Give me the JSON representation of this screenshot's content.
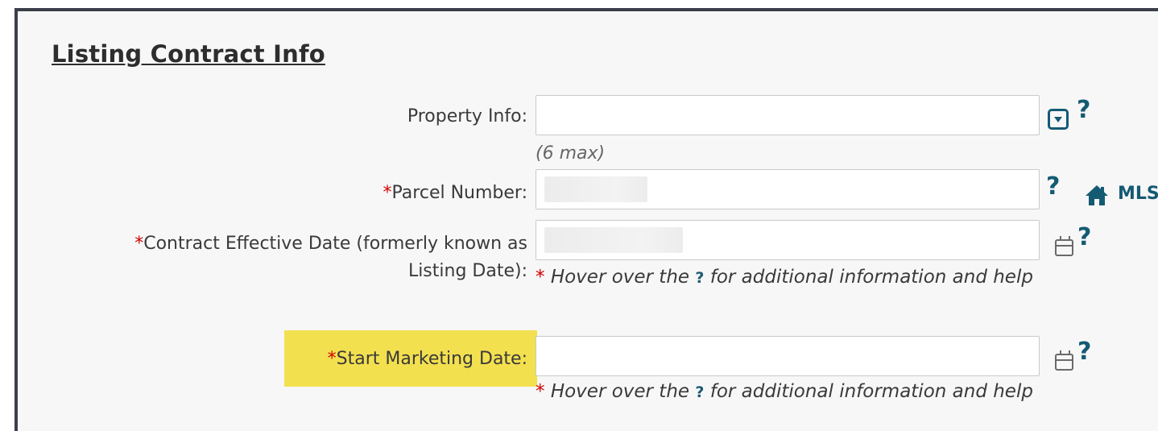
{
  "section": {
    "title": "Listing Contract Info"
  },
  "fields": {
    "property_info": {
      "label": "Property Info:",
      "value": "",
      "hint": "(6 max)"
    },
    "parcel_number": {
      "required_marker": "*",
      "label": "Parcel Number:",
      "value": ""
    },
    "contract_effective_date": {
      "required_marker": "*",
      "label_line1": "Contract Effective Date (formerly known as",
      "label_line2": "Listing Date):",
      "value": ""
    },
    "start_marketing_date": {
      "required_marker": "*",
      "label": "Start Marketing Date:",
      "value": ""
    }
  },
  "help_note": {
    "marker": "*",
    "before": "Hover over the",
    "q": "?",
    "after": "for additional information and help"
  },
  "links": {
    "mls_label": "MLS"
  },
  "icons": {
    "dropdown": "dropdown-box-icon",
    "help": "question-mark-icon",
    "calendar": "calendar-icon",
    "home": "home-icon"
  },
  "colors": {
    "accent": "#155a73",
    "required": "#d10000",
    "highlight": "#f3e04f"
  }
}
